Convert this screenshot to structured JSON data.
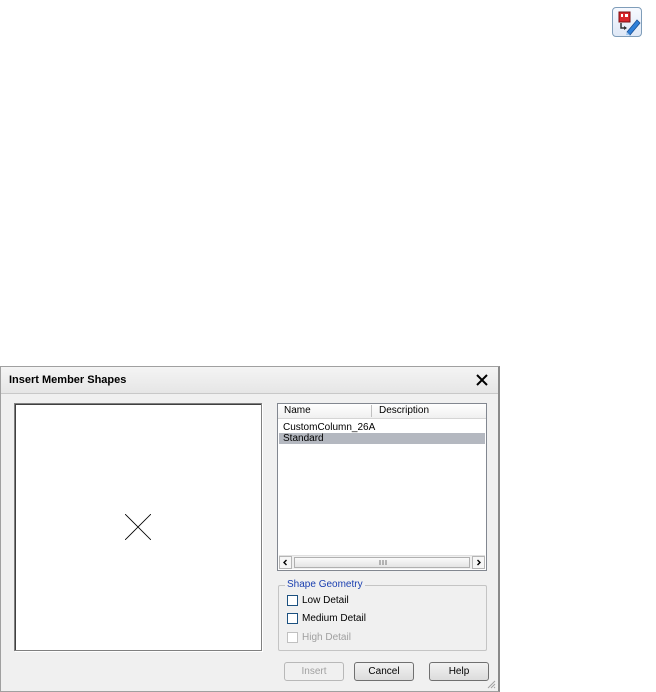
{
  "toolbar": {
    "icon": "insert-member-shapes-icon"
  },
  "dialog": {
    "title": "Insert Member Shapes",
    "close_icon": "close-icon",
    "list": {
      "columns": [
        "Name",
        "Description"
      ],
      "rows": [
        {
          "name": "CustomColumn_26A",
          "description": "",
          "selected": false
        },
        {
          "name": "Standard",
          "description": "",
          "selected": true
        }
      ]
    },
    "shape_geometry": {
      "legend": "Shape Geometry",
      "options": [
        {
          "label": "Low Detail",
          "checked": false,
          "enabled": true
        },
        {
          "label": "Medium Detail",
          "checked": false,
          "enabled": true
        },
        {
          "label": "High Detail",
          "checked": false,
          "enabled": false
        }
      ]
    },
    "buttons": {
      "insert": "Insert",
      "cancel": "Cancel",
      "help": "Help"
    },
    "colors": {
      "selection": "#b4b8c0",
      "legend": "#1a3fb0"
    }
  }
}
